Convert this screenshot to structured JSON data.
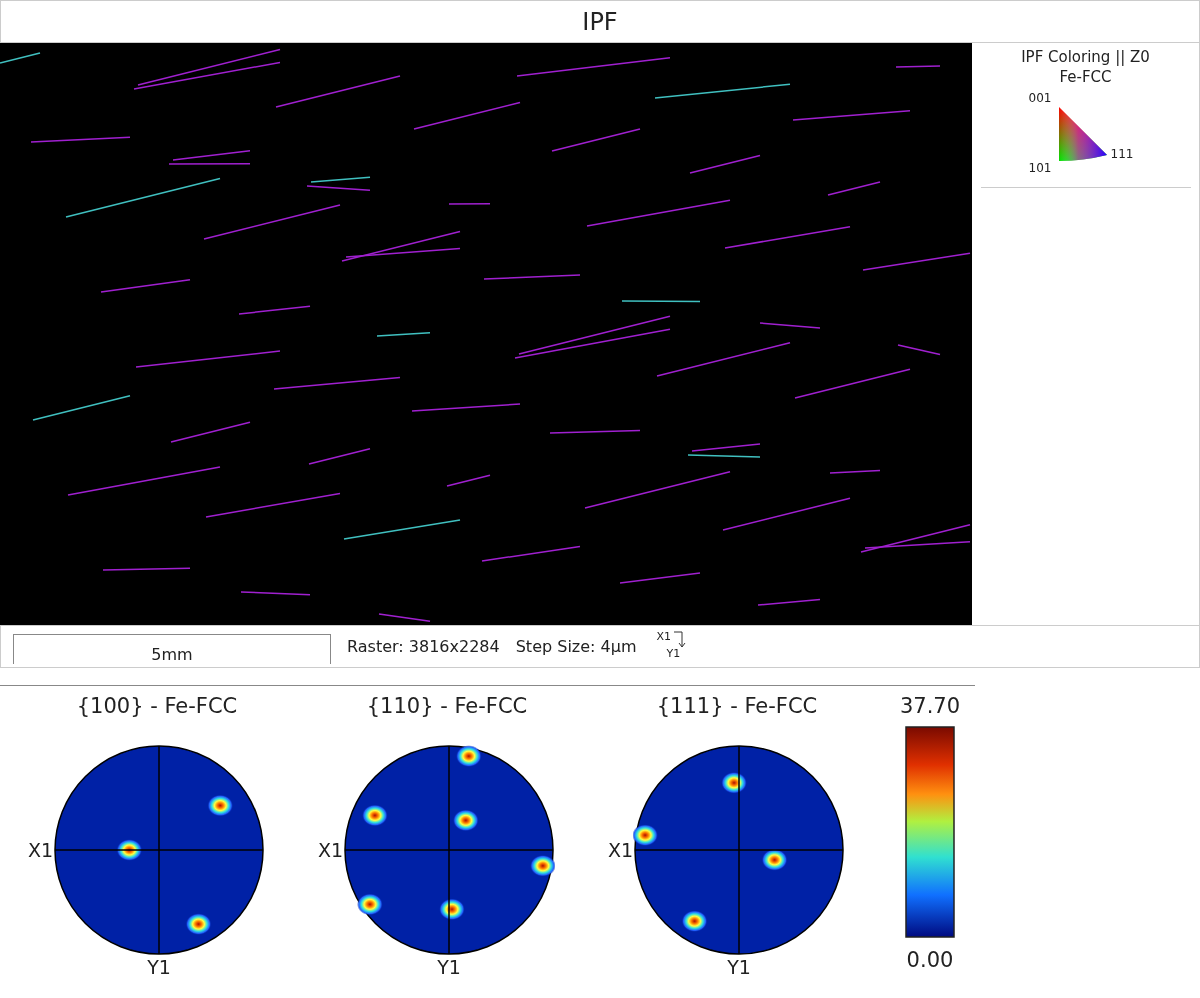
{
  "title": "IPF",
  "legend": {
    "heading": "IPF Coloring || Z0",
    "phase": "Fe-FCC",
    "corners": [
      "001",
      "101",
      "111"
    ]
  },
  "info_bar": {
    "scale_label": "5mm",
    "raster": "Raster: 3816x2284",
    "step_size": "Step Size: 4µm",
    "axis_x": "X1",
    "axis_y": "Y1"
  },
  "pole_figures": [
    {
      "title": "{100} - Fe-FCC",
      "x_label": "X1",
      "y_label": "Y1"
    },
    {
      "title": "{110} - Fe-FCC",
      "x_label": "X1",
      "y_label": "Y1"
    },
    {
      "title": "{111} - Fe-FCC",
      "x_label": "X1",
      "y_label": "Y1"
    }
  ],
  "color_scale": {
    "max": "37.70",
    "min": "0.00"
  }
}
